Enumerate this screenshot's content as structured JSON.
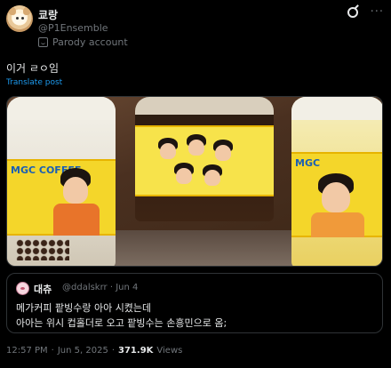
{
  "author": {
    "display_name": "쿄랑",
    "handle": "@P1Ensemble",
    "badge_text": "Parody account"
  },
  "post": {
    "text": "이거 ㄹㅇ임",
    "translate_label": "Translate post"
  },
  "media": {
    "label_text_left": "MGC COFFEE",
    "label_text_right": "MGC"
  },
  "quoted_post": {
    "display_name": "대츄",
    "handle": "@ddalskrr",
    "separator": "·",
    "date": "Jun 4",
    "line1": "메가커피 팥빙수랑 아아 시켰는데",
    "line2": "아아는 위시 컵홀더로 오고 팥빙수는 손흥민으로 옴;"
  },
  "footer": {
    "time": "12:57 PM",
    "dot1": "·",
    "date": "Jun 5, 2025",
    "dot2": "·",
    "views_count": "371.9K",
    "views_label": "Views"
  },
  "icons": {
    "grok": "grok-icon",
    "more": "more-icon",
    "parody": "parody-mask-icon"
  },
  "colors": {
    "background": "#000000",
    "text_primary": "#e7e9ea",
    "text_secondary": "#71767b",
    "link": "#1d9bf0",
    "border": "#2f3336",
    "label_yellow": "#f4d62a"
  }
}
